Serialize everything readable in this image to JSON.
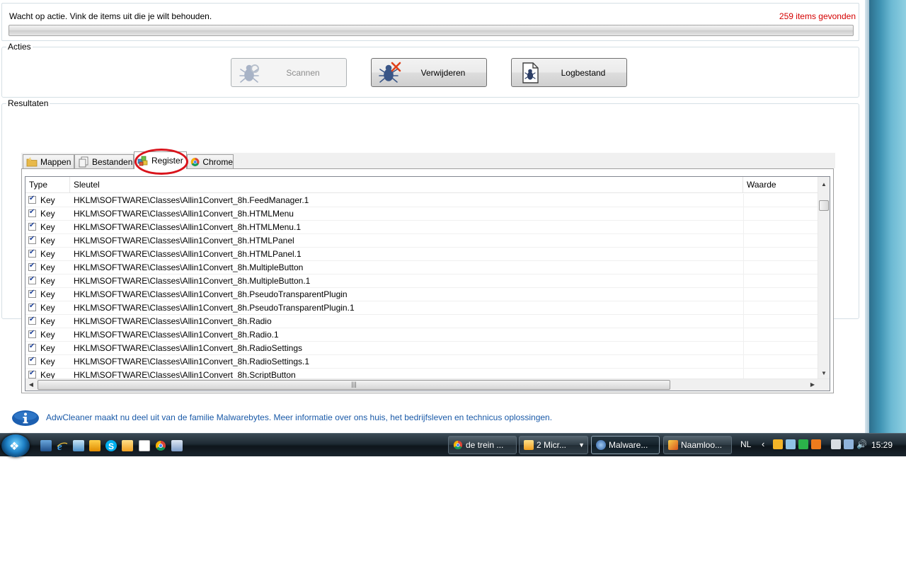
{
  "status": {
    "message": "Wacht op actie. Vink de items uit die je wilt behouden.",
    "found": "259 items gevonden",
    "progress": 0
  },
  "acties": {
    "title": "Acties",
    "scan_label": "Scannen",
    "delete_label": "Verwijderen",
    "log_label": "Logbestand"
  },
  "resultaten": {
    "title": "Resultaten",
    "tabs": [
      {
        "label": "Mappen",
        "icon": "folder-icon"
      },
      {
        "label": "Bestanden",
        "icon": "files-icon"
      },
      {
        "label": "Register",
        "icon": "registry-icon"
      },
      {
        "label": "Chrome",
        "icon": "chrome-icon"
      }
    ],
    "active_tab": "Register",
    "columns": {
      "type": "Type",
      "sleutel": "Sleutel",
      "waarde": "Waarde"
    },
    "rows": [
      {
        "checked": true,
        "type": "Key",
        "key": "HKLM\\SOFTWARE\\Classes\\Allin1Convert_8h.FeedManager.1",
        "value": ""
      },
      {
        "checked": true,
        "type": "Key",
        "key": "HKLM\\SOFTWARE\\Classes\\Allin1Convert_8h.HTMLMenu",
        "value": ""
      },
      {
        "checked": true,
        "type": "Key",
        "key": "HKLM\\SOFTWARE\\Classes\\Allin1Convert_8h.HTMLMenu.1",
        "value": ""
      },
      {
        "checked": true,
        "type": "Key",
        "key": "HKLM\\SOFTWARE\\Classes\\Allin1Convert_8h.HTMLPanel",
        "value": ""
      },
      {
        "checked": true,
        "type": "Key",
        "key": "HKLM\\SOFTWARE\\Classes\\Allin1Convert_8h.HTMLPanel.1",
        "value": ""
      },
      {
        "checked": true,
        "type": "Key",
        "key": "HKLM\\SOFTWARE\\Classes\\Allin1Convert_8h.MultipleButton",
        "value": ""
      },
      {
        "checked": true,
        "type": "Key",
        "key": "HKLM\\SOFTWARE\\Classes\\Allin1Convert_8h.MultipleButton.1",
        "value": ""
      },
      {
        "checked": true,
        "type": "Key",
        "key": "HKLM\\SOFTWARE\\Classes\\Allin1Convert_8h.PseudoTransparentPlugin",
        "value": ""
      },
      {
        "checked": true,
        "type": "Key",
        "key": "HKLM\\SOFTWARE\\Classes\\Allin1Convert_8h.PseudoTransparentPlugin.1",
        "value": ""
      },
      {
        "checked": true,
        "type": "Key",
        "key": "HKLM\\SOFTWARE\\Classes\\Allin1Convert_8h.Radio",
        "value": ""
      },
      {
        "checked": true,
        "type": "Key",
        "key": "HKLM\\SOFTWARE\\Classes\\Allin1Convert_8h.Radio.1",
        "value": ""
      },
      {
        "checked": true,
        "type": "Key",
        "key": "HKLM\\SOFTWARE\\Classes\\Allin1Convert_8h.RadioSettings",
        "value": ""
      },
      {
        "checked": true,
        "type": "Key",
        "key": "HKLM\\SOFTWARE\\Classes\\Allin1Convert_8h.RadioSettings.1",
        "value": ""
      },
      {
        "checked": true,
        "type": "Key",
        "key": "HKLM\\SOFTWARE\\Classes\\Allin1Convert_8h.ScriptButton",
        "value": ""
      }
    ]
  },
  "info": {
    "text": "AdwCleaner maakt nu deel uit van de familie Malwarebytes. Meer informatie over ons huis, het bedrijfsleven en technicus oplossingen."
  },
  "taskbar": {
    "buttons": [
      {
        "label": "de trein ...",
        "icon": "chrome-icon",
        "active": false
      },
      {
        "label": "2 Micr...",
        "icon": "outlook-icon",
        "active": false
      },
      {
        "label": "Malware...",
        "icon": "adwcleaner-icon",
        "active": true
      },
      {
        "label": "Naamloo...",
        "icon": "paint-icon",
        "active": false
      }
    ],
    "language": "NL",
    "clock": "15:29"
  },
  "colors": {
    "found_count": "#d40000",
    "info_text": "#1a5aa8",
    "highlight": "#d9141c"
  }
}
